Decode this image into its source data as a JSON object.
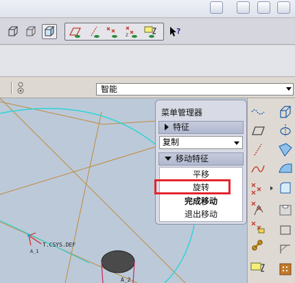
{
  "selection_filter": {
    "value": "智能"
  },
  "menu_manager": {
    "title": "菜单管理器",
    "feature_section": "特征",
    "copy_select": {
      "value": "复制"
    },
    "move_feature_section": "移动特征",
    "items": [
      {
        "label": "平移"
      },
      {
        "label": "旋转"
      },
      {
        "label": "完成移动"
      },
      {
        "label": "退出移动"
      }
    ]
  },
  "viewport": {
    "csys_label": "T.CSYS.DEF"
  },
  "colors": {
    "highlight": "#e5222b",
    "model_edge": "#29d6d6",
    "datum": "#c08a3a"
  }
}
